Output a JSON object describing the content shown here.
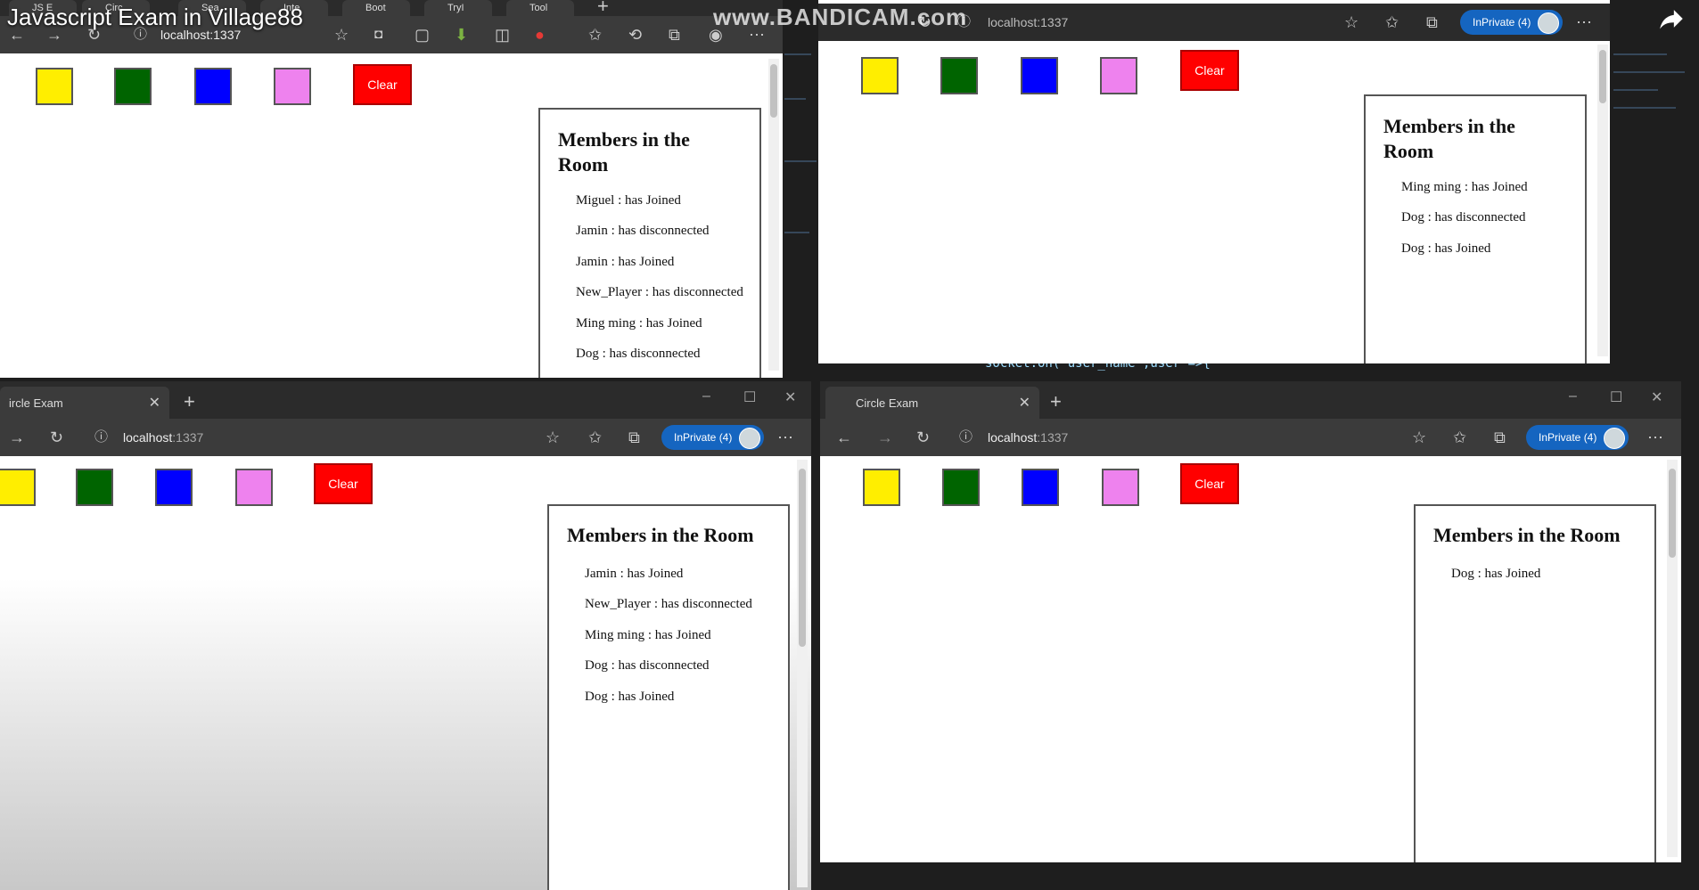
{
  "video": {
    "title": "Javascript Exam in Village88",
    "watermark": "www.BANDICAM.com"
  },
  "editor": {
    "code_snippet": "socket.on('user_name',user =>{"
  },
  "colors": {
    "yellow": "#ffee00",
    "green": "#006400",
    "blue": "#0000ff",
    "violet": "#ee82ee",
    "clear": "#ff0000",
    "inprivate": "#1565c0"
  },
  "common": {
    "address": "localhost:1337",
    "address_host": "localhost",
    "address_port": ":1337",
    "inprivate_label": "InPrivate (4)",
    "clear_label": "Clear",
    "panel_title": "Members in the Room",
    "tab_title_full": "Circle Exam",
    "tab_title_cut": "ircle Exam"
  },
  "windows": {
    "top_left": {
      "tabs": [
        "JS E",
        "Circ",
        "Sea",
        "Inte",
        "Boot",
        "TryI",
        "Tool"
      ],
      "members": [
        "Miguel : has Joined",
        "Jamin : has disconnected",
        "Jamin : has Joined",
        "New_Player : has disconnected",
        "Ming ming : has Joined",
        "Dog : has disconnected"
      ]
    },
    "top_right": {
      "members": [
        "Ming ming : has Joined",
        "Dog : has disconnected",
        "Dog : has Joined"
      ]
    },
    "bottom_left": {
      "members": [
        "Jamin : has Joined",
        "New_Player : has disconnected",
        "Ming ming : has Joined",
        "Dog : has disconnected",
        "Dog : has Joined"
      ]
    },
    "bottom_right": {
      "members": [
        "Dog : has Joined"
      ]
    }
  }
}
